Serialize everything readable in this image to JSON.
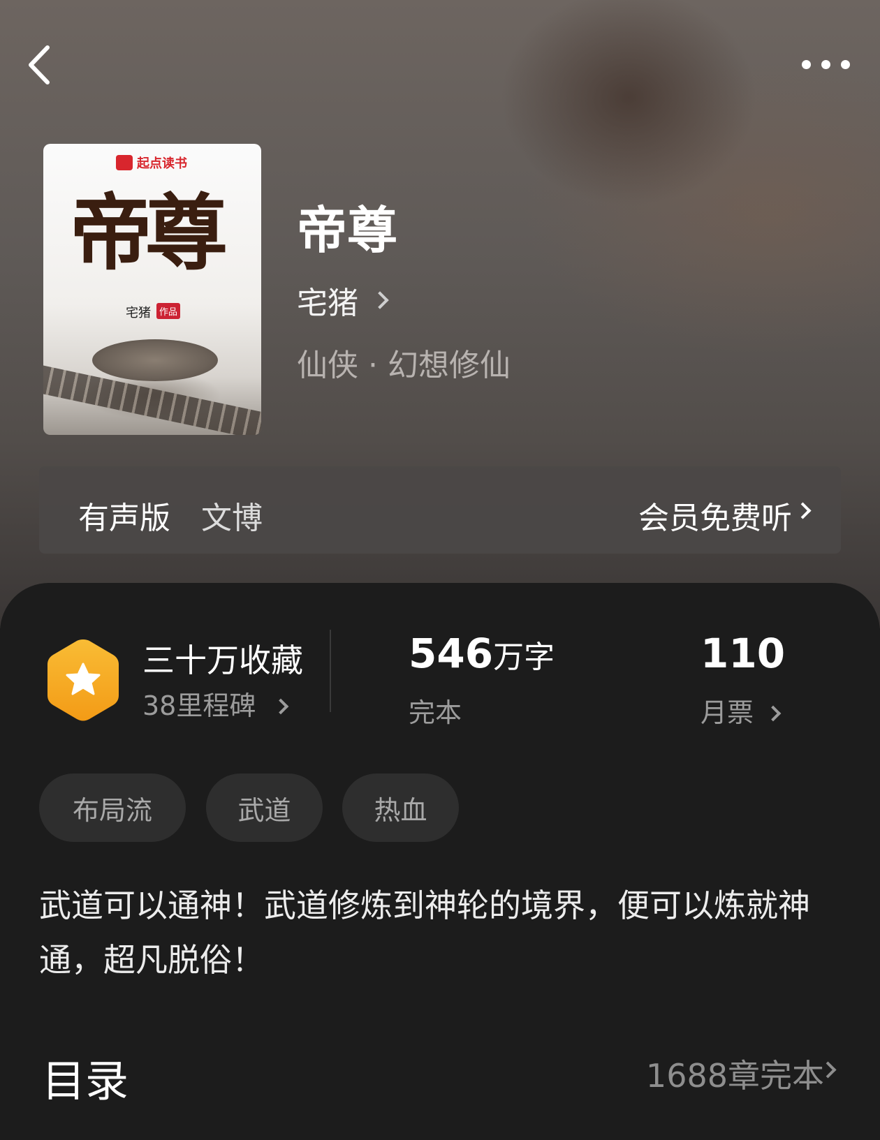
{
  "book": {
    "cover_brand": "起点读书",
    "cover_title": "帝尊",
    "cover_author": "宅猪",
    "cover_author_tag": "作品",
    "title": "帝尊",
    "author": "宅猪",
    "category": "仙侠 · 幻想修仙"
  },
  "audio": {
    "label": "有声版",
    "narrator": "文博",
    "action": "会员免费听"
  },
  "stats": {
    "favorites_label": "三十万收藏",
    "milestones": "38里程碑",
    "word_count": "546",
    "word_unit": "万字",
    "status": "完本",
    "monthly_tickets": "110",
    "monthly_tickets_label": "月票"
  },
  "tags": [
    "布局流",
    "武道",
    "热血"
  ],
  "description": "武道可以通神！武道修炼到神轮的境界，便可以炼就神通，超凡脱俗！",
  "toc": {
    "title": "目录",
    "summary": "1688章完本"
  },
  "colors": {
    "badge_gold": "#f8b52c",
    "badge_orange": "#f5a51d",
    "panel_bg": "#1c1c1c",
    "tag_bg": "#2e2e2e"
  },
  "icons": [
    "back-arrow-icon",
    "more-dots-icon",
    "star-hexagon-icon",
    "chevron-right-icon"
  ]
}
